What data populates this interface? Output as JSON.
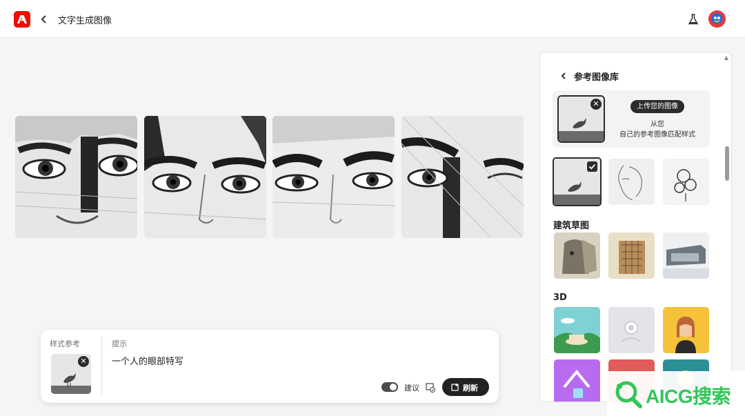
{
  "header": {
    "title": "文字生成图像"
  },
  "gallery": {
    "count": 4
  },
  "prompt_panel": {
    "style_ref_label": "样式参考",
    "prompt_label": "提示",
    "prompt_text": "一个人的眼部特写",
    "suggest_label": "建议",
    "refresh_label": "刷新"
  },
  "sidebar": {
    "title": "参考图像库",
    "upload_button": "上传您的图像",
    "upload_line1": "从您",
    "upload_line2": "自己的参考图像匹配样式",
    "section_architecture": "建筑草图",
    "section_3d": "3D"
  },
  "watermark": {
    "text": "AICG搜索"
  },
  "colors": {
    "brand": "#eb1000",
    "watermark": "#33c65a",
    "dark_button": "#222222"
  }
}
